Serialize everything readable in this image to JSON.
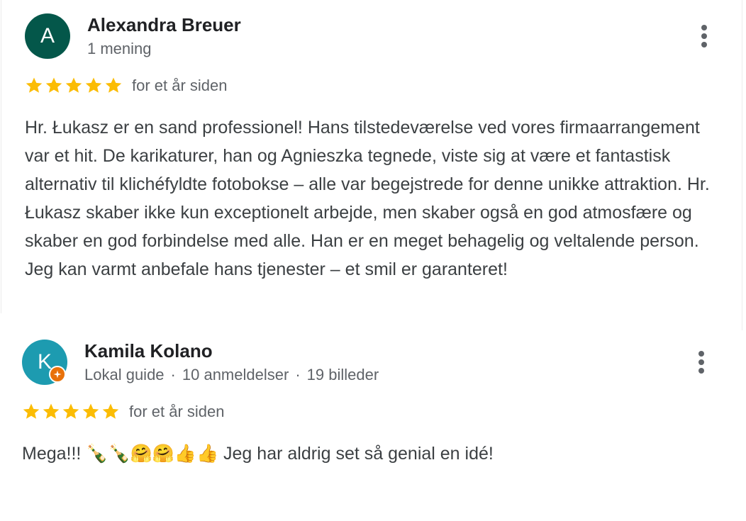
{
  "reviews": [
    {
      "avatar_letter": "A",
      "avatar_color": "#04574a",
      "name": "Alexandra Breuer",
      "meta": [
        "1 mening"
      ],
      "rating": 5,
      "date": "for et år siden",
      "text": "Hr. Łukasz er en sand professionel! Hans tilstedeværelse ved vores firmaarrangement var et hit. De karikaturer, han og Agnieszka tegnede, viste sig at være et fantastisk alternativ til klichéfyldte fotobokse – alle var begejstrede for denne unikke attraktion. Hr. Łukasz skaber ikke kun exceptionelt arbejde, men skaber også en god atmosfære og skaber en god forbindelse med alle. Han er en meget behagelig og veltalende person. Jeg kan varmt anbefale hans tjenester – et smil er garanteret!"
    },
    {
      "avatar_letter": "K",
      "avatar_color": "#1d9bb0",
      "badge_icon": "local-guide-badge-icon",
      "name": "Kamila Kolano",
      "meta": [
        "Lokal guide",
        "10 anmeldelser",
        "19 billeder"
      ],
      "rating": 5,
      "date": "for et år siden",
      "text": "Mega!!! 🍾🍾🤗🤗👍👍 Jeg har aldrig set så genial en idé!"
    }
  ],
  "icons": {
    "star": "star-icon",
    "more": "more-vert-icon"
  },
  "colors": {
    "star": "#fbbc04",
    "secondary_text": "#5f6368",
    "guide_badge": "#e8710a"
  }
}
